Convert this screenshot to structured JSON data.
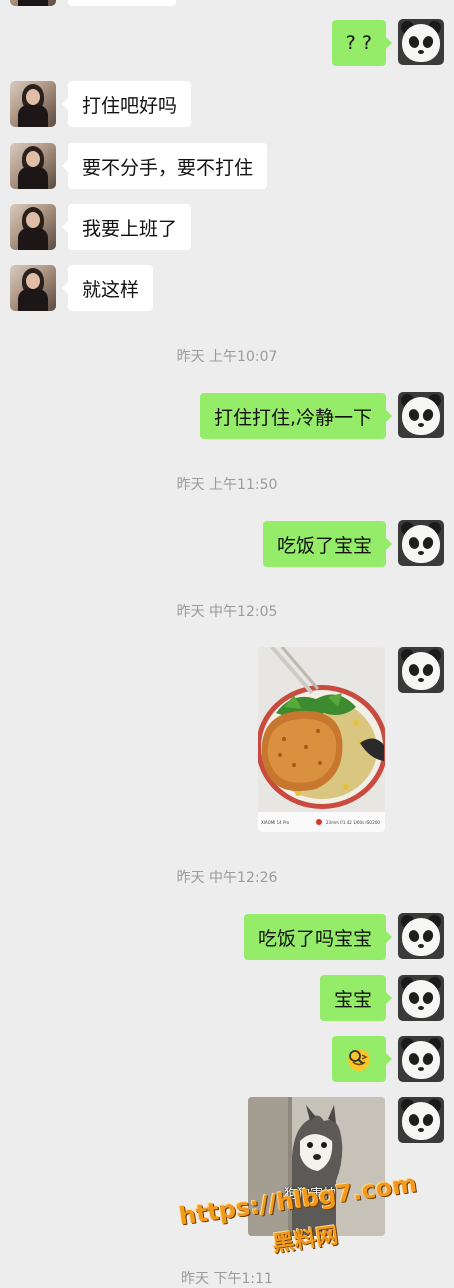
{
  "messages": {
    "m1": "? ?",
    "m2": "打住吧好吗",
    "m3": "要不分手，要不打住",
    "m4": "我要上班了",
    "m5": "就这样",
    "m6": "打住打住,冷静一下",
    "m7": "吃饭了宝宝",
    "m8": "吃饭了吗宝宝",
    "m9": "宝宝"
  },
  "timestamps": {
    "t1": "昨天 上午10:07",
    "t2": "昨天 上午11:50",
    "t3": "昨天 中午12:05",
    "t4": "昨天 中午12:26",
    "t5": "昨天 下午1:11"
  },
  "photo": {
    "left_caption": "XIAOMI 14 Pro",
    "right_caption": "23mm  f/1.42  1/60s  ISO200"
  },
  "sticker": {
    "caption": "狗狗害怕"
  },
  "watermark": {
    "url": "https://hlbg7.com",
    "name": "黑料网"
  },
  "colors": {
    "background": "#ededed",
    "sent_bubble": "#95ec69",
    "received_bubble": "#ffffff",
    "timestamp": "#9b9b9b"
  }
}
